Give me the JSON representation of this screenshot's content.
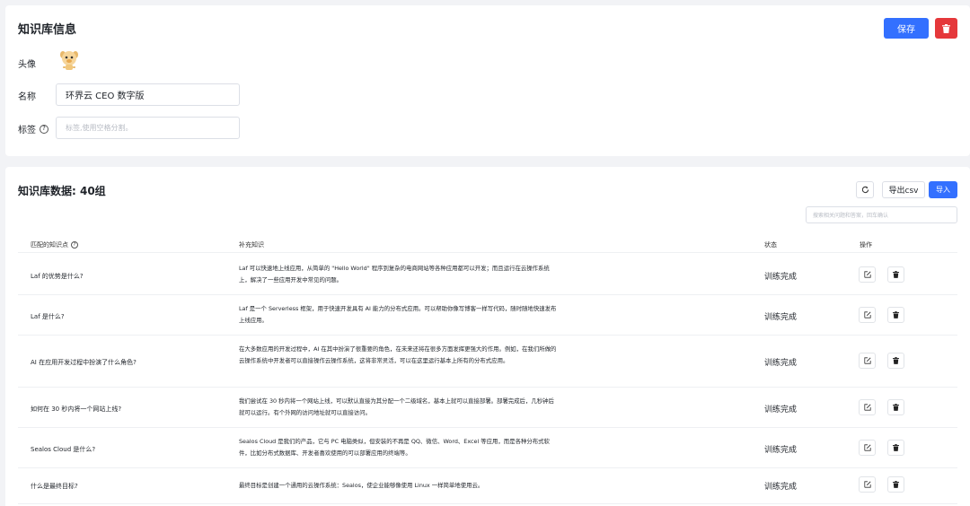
{
  "info": {
    "title": "知识库信息",
    "save_label": "保存",
    "avatar_label": "头像",
    "name_label": "名称",
    "name_value": "环界云 CEO 数字版",
    "tags_label": "标签",
    "tags_placeholder": "标签,使用空格分割。"
  },
  "data": {
    "title": "知识库数据: 40组",
    "export_label": "导出csv",
    "import_label": "导入",
    "search_placeholder": "搜索相关问题和答案，回车确认",
    "columns": {
      "question": "匹配的知识点",
      "answer": "补充知识",
      "status": "状态",
      "ops": "操作"
    },
    "rows": [
      {
        "question": "Laf 的优势是什么?",
        "answer": "Laf 可以快速地上线应用，从简单的 \"Hello World\" 程序到复杂的电商网站等各种应用都可以开发；而且运行在云操作系统上，解决了一些应用开发中常见的问题。",
        "status": "训练完成"
      },
      {
        "question": "Laf 是什么?",
        "answer": "Laf 是一个 Serverless 框架，用于快速开发具有 AI 能力的分布式应用。可以帮助你像写博客一样写代码，随时随地快速发布上线应用。",
        "status": "训练完成"
      },
      {
        "question": "AI 在应用开发过程中扮演了什么角色?",
        "answer": "在大多数应用的开发过程中，AI 在其中扮演了很重要的角色，在未来还将在很多方面发挥更强大的作用。例如，在我们所做的云操作系统中开发者可以直接操作云操作系统，这将非常灵活，可以在这里运行基本上所有的分布式应用。",
        "status": "训练完成"
      },
      {
        "question": "如何在 30 秒内将一个网站上线?",
        "answer": "我们尝试在 30 秒内将一个网站上线，可以默认直接为其分配一个二级域名，基本上就可以直接部署。部署完成后，几秒钟后就可以运行。有个外网的访问地址就可以直接访问。",
        "status": "训练完成"
      },
      {
        "question": "Sealos Cloud 是什么?",
        "answer": "Sealos Cloud 是我们的产品，它与 PC 电脑类似，但安装的不再是 QQ、微信、Word、Excel 等应用，而是各种分布式软件，比如分布式数据库、开发者喜欢使用的可以部署应用的终端等。",
        "status": "训练完成"
      },
      {
        "question": "什么是最终目标?",
        "answer": "最终目标是创建一个通用的云操作系统：Sealos，使企业能够像使用 Linux 一样简单地使用云。",
        "status": "训练完成"
      }
    ]
  },
  "colors": {
    "primary": "#3370ff",
    "danger": "#e5383b",
    "background": "#f2f3f6"
  },
  "icons": {
    "delete": "trash-icon",
    "edit": "edit-icon",
    "refresh": "refresh-icon",
    "help": "help-circle-icon",
    "avatar": "mascot-avatar"
  }
}
